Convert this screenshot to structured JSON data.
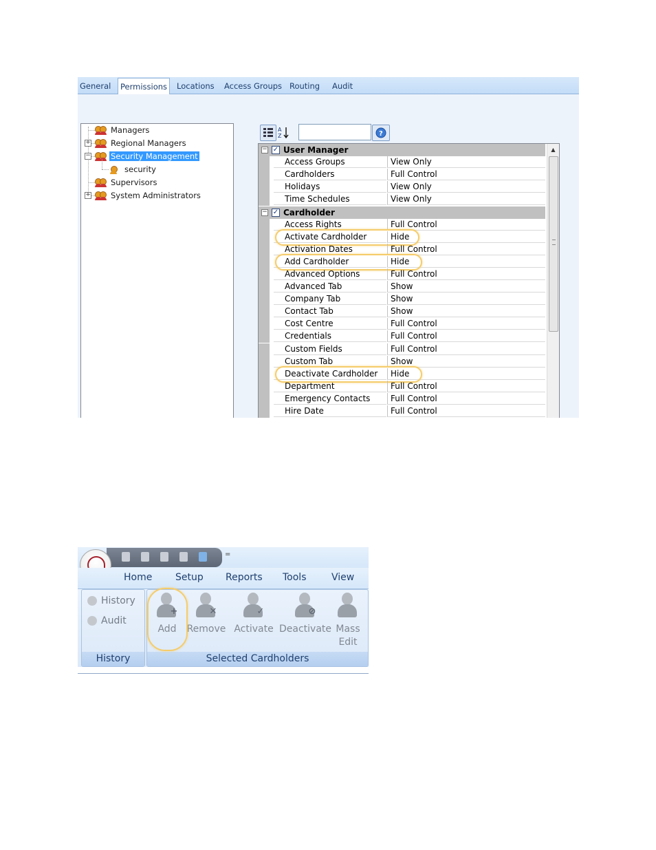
{
  "shot1": {
    "tabs": [
      "General",
      "Permissions",
      "Locations",
      "Access Groups",
      "Routing",
      "Audit"
    ],
    "active_tab": "Permissions",
    "tree": [
      {
        "label": "Managers",
        "expander": "",
        "selected": false
      },
      {
        "label": "Regional Managers",
        "expander": "+",
        "selected": false
      },
      {
        "label": "Security Management",
        "expander": "−",
        "selected": true
      },
      {
        "label": "security",
        "expander": "",
        "selected": false
      },
      {
        "label": "Supervisors",
        "expander": "",
        "selected": false
      },
      {
        "label": "System Administrators",
        "expander": "+",
        "selected": false
      }
    ],
    "toolbar": {
      "sort_glyph": "A Z",
      "help_glyph": "?",
      "search_value": ""
    },
    "categories": [
      {
        "name": "User Manager",
        "rows": [
          {
            "name": "Access Groups",
            "value": "View Only"
          },
          {
            "name": "Cardholders",
            "value": "Full Control"
          },
          {
            "name": "Holidays",
            "value": "View Only"
          },
          {
            "name": "Time Schedules",
            "value": "View Only"
          }
        ]
      },
      {
        "name": "Cardholder",
        "rows": [
          {
            "name": "Access Rights",
            "value": "Full Control"
          },
          {
            "name": "Activate Cardholder",
            "value": "Hide"
          },
          {
            "name": "Activation Dates",
            "value": "Full Control"
          },
          {
            "name": "Add Cardholder",
            "value": "Hide"
          },
          {
            "name": "Advanced Options",
            "value": "Full Control"
          },
          {
            "name": "Advanced Tab",
            "value": "Show"
          },
          {
            "name": "Company Tab",
            "value": "Show"
          },
          {
            "name": "Contact Tab",
            "value": "Show"
          },
          {
            "name": "Cost Centre",
            "value": "Full Control"
          },
          {
            "name": "Credentials",
            "value": "Full Control"
          },
          {
            "name": "Custom Fields",
            "value": "Full Control"
          },
          {
            "name": "Custom Tab",
            "value": "Show"
          },
          {
            "name": "Deactivate Cardholder",
            "value": "Hide"
          },
          {
            "name": "Department",
            "value": "Full Control"
          },
          {
            "name": "Emergency Contacts",
            "value": "Full Control"
          },
          {
            "name": "Hire Date",
            "value": "Full Control"
          }
        ]
      }
    ],
    "highlighted_rows": [
      "Activate Cardholder",
      "Add Cardholder",
      "Deactivate Cardholder"
    ],
    "highlight_color": "#f5cc6a"
  },
  "shot2": {
    "menus": [
      "Home",
      "Setup",
      "Reports",
      "Tools",
      "View"
    ],
    "history_group": {
      "items": [
        {
          "label": "History",
          "icon": "history-icon"
        },
        {
          "label": "Audit",
          "icon": "audit-icon"
        }
      ],
      "caption": "History"
    },
    "cardholder_group": {
      "buttons": [
        {
          "label": "Add",
          "icon": "add-cardholder-icon",
          "badge": "+"
        },
        {
          "label": "Remove",
          "icon": "remove-cardholder-icon",
          "badge": "✕"
        },
        {
          "label": "Activate",
          "icon": "activate-cardholder-icon",
          "badge": "✓"
        },
        {
          "label": "Deactivate",
          "icon": "deactivate-cardholder-icon",
          "badge": "⊘"
        },
        {
          "label": "Mass\nEdit",
          "icon": "mass-edit-icon",
          "badge": ""
        }
      ],
      "caption": "Selected Cardholders"
    },
    "highlighted_button": "Add",
    "qat_dropdown": "="
  }
}
